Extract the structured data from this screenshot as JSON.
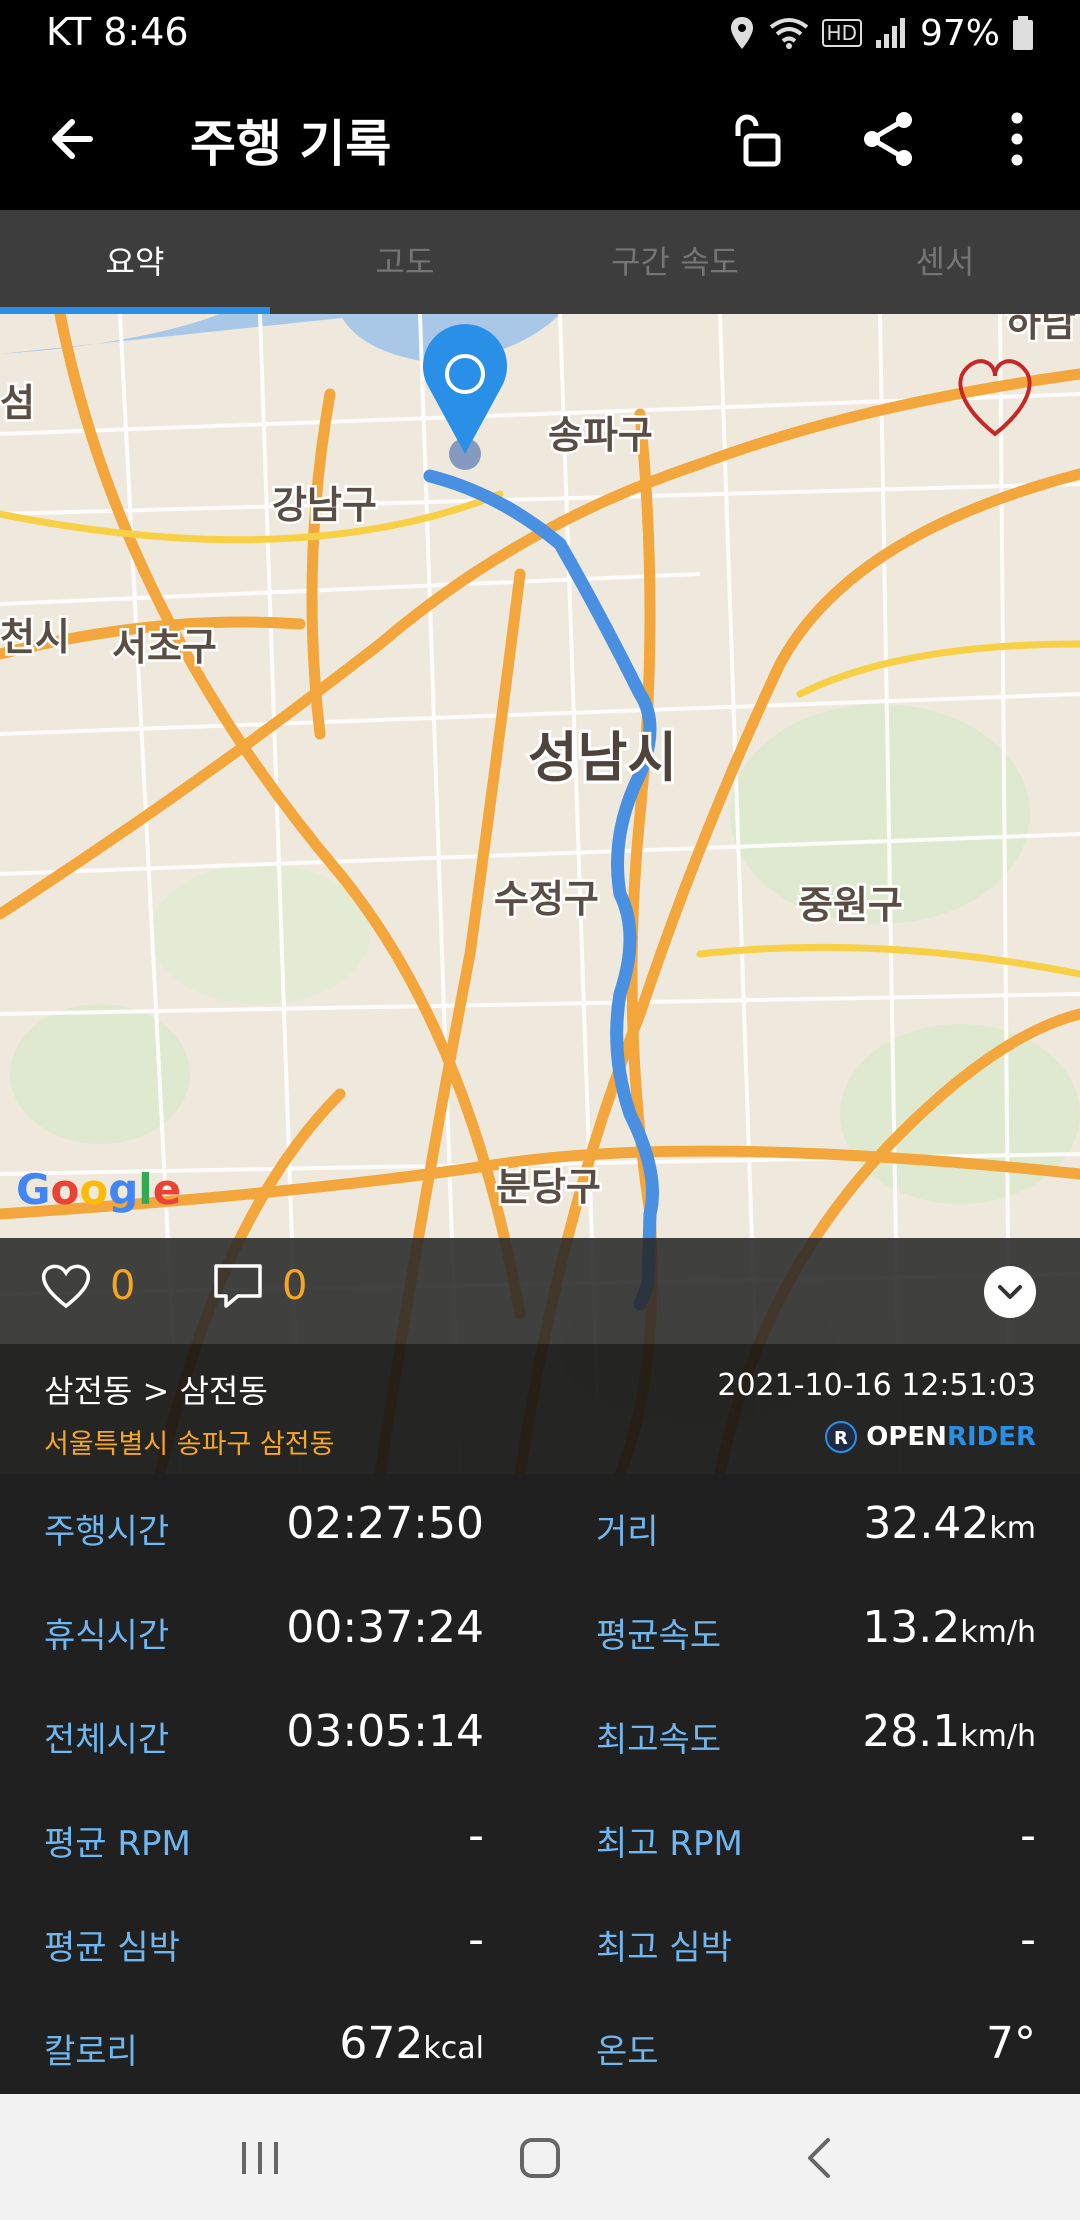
{
  "status": {
    "carrier_time": "KT 8:46",
    "battery": "97%",
    "hd": "HD"
  },
  "app_bar": {
    "title": "주행 기록",
    "back_icon": "arrow-left-icon",
    "lock_icon": "unlock-icon",
    "share_icon": "share-icon",
    "menu_icon": "more-vertical-icon"
  },
  "tabs": [
    {
      "label": "요약",
      "active": true
    },
    {
      "label": "고도",
      "active": false
    },
    {
      "label": "구간 속도",
      "active": false
    },
    {
      "label": "센서",
      "active": false
    }
  ],
  "map": {
    "labels": {
      "gangnam": "강남구",
      "songpa": "송파구",
      "seocho": "서초구",
      "sujeong": "수정구",
      "jungwon": "중원구",
      "seongnam": "성남시",
      "bundang": "분당구",
      "edge_left_top": "섬",
      "edge_left_mid": "천시",
      "edge_right_top": "하남"
    },
    "attribution": "Google",
    "route_color": "#4a90e2",
    "marker_color": "#2a8fe6"
  },
  "social": {
    "likes": "0",
    "comments": "0"
  },
  "route_info": {
    "route": "삼전동 > 삼전동",
    "address": "서울특별시 송파구 삼전동",
    "datetime": "2021-10-16 12:51:03",
    "brand_open": "OPEN",
    "brand_rider": "RIDER"
  },
  "stats": [
    {
      "left_label": "주행시간",
      "left_value": "02:27:50",
      "left_unit": "",
      "right_label": "거리",
      "right_value": "32.42",
      "right_unit": "km"
    },
    {
      "left_label": "휴식시간",
      "left_value": "00:37:24",
      "left_unit": "",
      "right_label": "평균속도",
      "right_value": "13.2",
      "right_unit": "km/h"
    },
    {
      "left_label": "전체시간",
      "left_value": "03:05:14",
      "left_unit": "",
      "right_label": "최고속도",
      "right_value": "28.1",
      "right_unit": "km/h"
    },
    {
      "left_label": "평균 RPM",
      "left_value": "-",
      "left_unit": "",
      "right_label": "최고 RPM",
      "right_value": "-",
      "right_unit": ""
    },
    {
      "left_label": "평균 심박",
      "left_value": "-",
      "left_unit": "",
      "right_label": "최고 심박",
      "right_value": "-",
      "right_unit": ""
    },
    {
      "left_label": "칼로리",
      "left_value": "672",
      "left_unit": "kcal",
      "right_label": "온도",
      "right_value": "7°",
      "right_unit": ""
    }
  ]
}
